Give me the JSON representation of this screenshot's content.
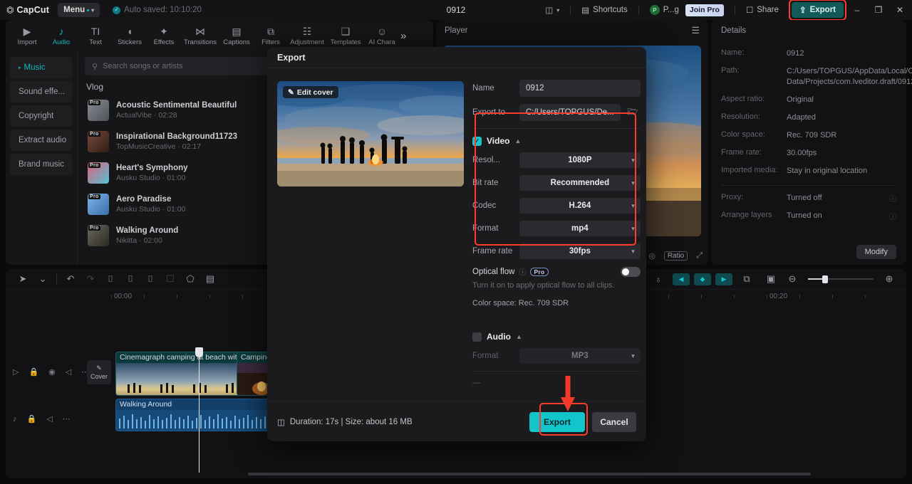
{
  "titlebar": {
    "app_name": "CapCut",
    "menu_label": "Menu",
    "autosave_text": "Auto saved: 10:10:20",
    "project_title": "0912",
    "layout_icon": "layout-icon",
    "shortcuts_label": "Shortcuts",
    "account_initial": "P",
    "account_label": "P...g",
    "join_pro_label": "Join Pro",
    "share_label": "Share",
    "export_label": "Export",
    "minimize_glyph": "–",
    "maximize_glyph": "❐",
    "close_glyph": "✕"
  },
  "tooltabs": [
    {
      "label": "Import",
      "icon": "import-icon",
      "glyph": "▶",
      "active": false
    },
    {
      "label": "Audio",
      "icon": "audio-note-icon",
      "glyph": "♪",
      "active": true
    },
    {
      "label": "Text",
      "icon": "text-icon",
      "glyph": "TI",
      "active": false
    },
    {
      "label": "Stickers",
      "icon": "sticker-icon",
      "glyph": "◖",
      "active": false
    },
    {
      "label": "Effects",
      "icon": "effects-sparkle-icon",
      "glyph": "✦",
      "active": false
    },
    {
      "label": "Transitions",
      "icon": "transitions-icon",
      "glyph": "⋈",
      "active": false
    },
    {
      "label": "Captions",
      "icon": "captions-icon",
      "glyph": "▤",
      "active": false
    },
    {
      "label": "Filters",
      "icon": "filters-icon",
      "glyph": "⧉",
      "active": false
    },
    {
      "label": "Adjustment",
      "icon": "adjustment-sliders-icon",
      "glyph": "☷",
      "active": false
    },
    {
      "label": "Templates",
      "icon": "templates-icon",
      "glyph": "❑",
      "active": false
    },
    {
      "label": "AI Chara",
      "icon": "ai-character-icon",
      "glyph": "☺",
      "active": false
    }
  ],
  "tooltabs_more_glyph": "»",
  "left_panel": {
    "nav": [
      {
        "label": "Music",
        "active": true
      },
      {
        "label": "Sound effe...",
        "active": false
      },
      {
        "label": "Copyright",
        "active": false
      },
      {
        "label": "Extract audio",
        "active": false
      },
      {
        "label": "Brand music",
        "active": false
      }
    ],
    "search_placeholder": "Search songs or artists",
    "search_icon": "search-icon",
    "section_title": "Vlog",
    "pro_tag": "Pro",
    "songs": [
      {
        "name": "Acoustic Sentimental Beautiful",
        "meta": "ActualVibe · 02:28",
        "color1": "#8a8f96",
        "color2": "#4c5057"
      },
      {
        "name": "Inspirational Background11723",
        "meta": "TopMusicCreative · 02:17",
        "color1": "#7a4a3a",
        "color2": "#2e1d17"
      },
      {
        "name": "Heart's Symphony",
        "meta": "Ausku Studio · 01:00",
        "color1": "#e0607a",
        "color2": "#55c2d6"
      },
      {
        "name": "Aero Paradise",
        "meta": "Ausku Studio · 01:00",
        "color1": "#7fb6e8",
        "color2": "#3a6ea8"
      },
      {
        "name": "Walking Around",
        "meta": "Nikitta · 02:00",
        "color1": "#6d6a60",
        "color2": "#2a2823"
      }
    ]
  },
  "player": {
    "title": "Player",
    "menu_icon": "hamburger-icon",
    "zoom_icon": "magnifier-frame-icon",
    "ratio_label": "Ratio",
    "fullscreen_icon": "fullscreen-icon"
  },
  "details": {
    "title": "Details",
    "rows": [
      {
        "key": "Name:",
        "value": "0912",
        "help": false
      },
      {
        "key": "Path:",
        "value": "C:/Users/TOPGUS/AppData/Local/CapCut/User Data/Projects/com.lveditor.draft/0912",
        "help": false
      },
      {
        "key": "Aspect ratio:",
        "value": "Original",
        "help": false
      },
      {
        "key": "Resolution:",
        "value": "Adapted",
        "help": false
      },
      {
        "key": "Color space:",
        "value": "Rec. 709 SDR",
        "help": false
      },
      {
        "key": "Frame rate:",
        "value": "30.00fps",
        "help": false
      },
      {
        "key": "Imported media:",
        "value": "Stay in original location",
        "help": false
      }
    ],
    "rows2": [
      {
        "key": "Proxy:",
        "value": "Turned off",
        "help": true
      },
      {
        "key": "Arrange layers",
        "value": "Turned on",
        "help": true
      }
    ],
    "modify_label": "Modify"
  },
  "timeline": {
    "toolbar_left": [
      {
        "icon": "select-cursor-icon",
        "glyph": "➤",
        "dim": false
      },
      {
        "icon": "chevron-down-icon",
        "glyph": "⌄",
        "dim": false
      },
      {
        "icon": "undo-icon",
        "glyph": "↶",
        "dim": false
      },
      {
        "icon": "redo-icon",
        "glyph": "↷",
        "dim": true
      },
      {
        "icon": "split-icon",
        "glyph": "⌷",
        "dim": false
      },
      {
        "icon": "trim-left-icon",
        "glyph": "⌷",
        "dim": false
      },
      {
        "icon": "trim-right-icon",
        "glyph": "⌷",
        "dim": false
      },
      {
        "icon": "delete-icon",
        "glyph": "☐",
        "dim": true
      },
      {
        "icon": "freeze-shield-icon",
        "glyph": "⬠",
        "dim": false
      },
      {
        "icon": "auto-caption-icon",
        "glyph": "▤",
        "dim": false
      }
    ],
    "toolbar_right": [
      {
        "icon": "microphone-icon",
        "glyph": "♁",
        "teal": false
      },
      {
        "icon": "keyframe-prev-icon",
        "glyph": "◀",
        "teal": true
      },
      {
        "icon": "keyframe-add-icon",
        "glyph": "◆",
        "teal": true
      },
      {
        "icon": "keyframe-next-icon",
        "glyph": "▶",
        "teal": true
      },
      {
        "icon": "mirror-icon",
        "glyph": "⧉",
        "teal": false
      },
      {
        "icon": "preview-render-icon",
        "glyph": "▣",
        "teal": false
      }
    ],
    "zoom_out_icon": "zoom-out-icon",
    "zoom_in_icon": "zoom-in-icon",
    "ruler_labels": [
      "00:00",
      "00:20"
    ],
    "cover_label": "Cover",
    "cover_icon": "pencil-icon",
    "clips": [
      {
        "label": "Cinemagraph camping at beach with b",
        "type": "video"
      },
      {
        "label": "Camping",
        "type": "video"
      }
    ],
    "audio_clip_label": "Walking Around",
    "track_controls": [
      [
        {
          "icon": "video-track-icon",
          "glyph": "▷"
        },
        {
          "icon": "lock-icon",
          "glyph": "🔒"
        },
        {
          "icon": "eye-icon",
          "glyph": "◉"
        },
        {
          "icon": "volume-icon",
          "glyph": "◁"
        },
        {
          "icon": "more-icon",
          "glyph": "⋯"
        }
      ],
      [
        {
          "icon": "audio-track-icon",
          "glyph": "♪"
        },
        {
          "icon": "lock-icon",
          "glyph": "🔒"
        },
        {
          "icon": "volume-icon",
          "glyph": "◁"
        },
        {
          "icon": "more-icon",
          "glyph": "⋯"
        }
      ]
    ]
  },
  "export_dialog": {
    "title": "Export",
    "edit_cover_label": "Edit cover",
    "edit_cover_icon": "pencil-icon",
    "name_label": "Name",
    "name_value": "0912",
    "export_to_label": "Export to",
    "export_to_value": "C:/Users/TOPGUS/De...",
    "folder_icon": "folder-icon",
    "video_section": {
      "label": "Video",
      "checked": true,
      "collapse_glyph": "▲",
      "fields": [
        {
          "label": "Resol...",
          "value": "1080P"
        },
        {
          "label": "Bit rate",
          "value": "Recommended"
        },
        {
          "label": "Codec",
          "value": "H.264"
        },
        {
          "label": "Format",
          "value": "mp4"
        },
        {
          "label": "Frame rate",
          "value": "30fps"
        }
      ]
    },
    "optical_flow": {
      "label": "Optical flow",
      "help_glyph": "ⓘ",
      "pro_badge": "Pro",
      "enabled": false,
      "hint": "Turn it on to apply optical flow to all clips."
    },
    "color_space_text": "Color space: Rec. 709 SDR",
    "audio_section": {
      "label": "Audio",
      "checked": false,
      "collapse_glyph": "▲",
      "fields": [
        {
          "label": "Format",
          "value": "MP3"
        }
      ]
    },
    "footer": {
      "duration_icon": "film-icon",
      "duration_text": "Duration: 17s | Size: about 16 MB",
      "export_label": "Export",
      "cancel_label": "Cancel"
    }
  },
  "annotations": {
    "highlight_color": "#ff3b30",
    "arrow_color": "#f5392b"
  }
}
